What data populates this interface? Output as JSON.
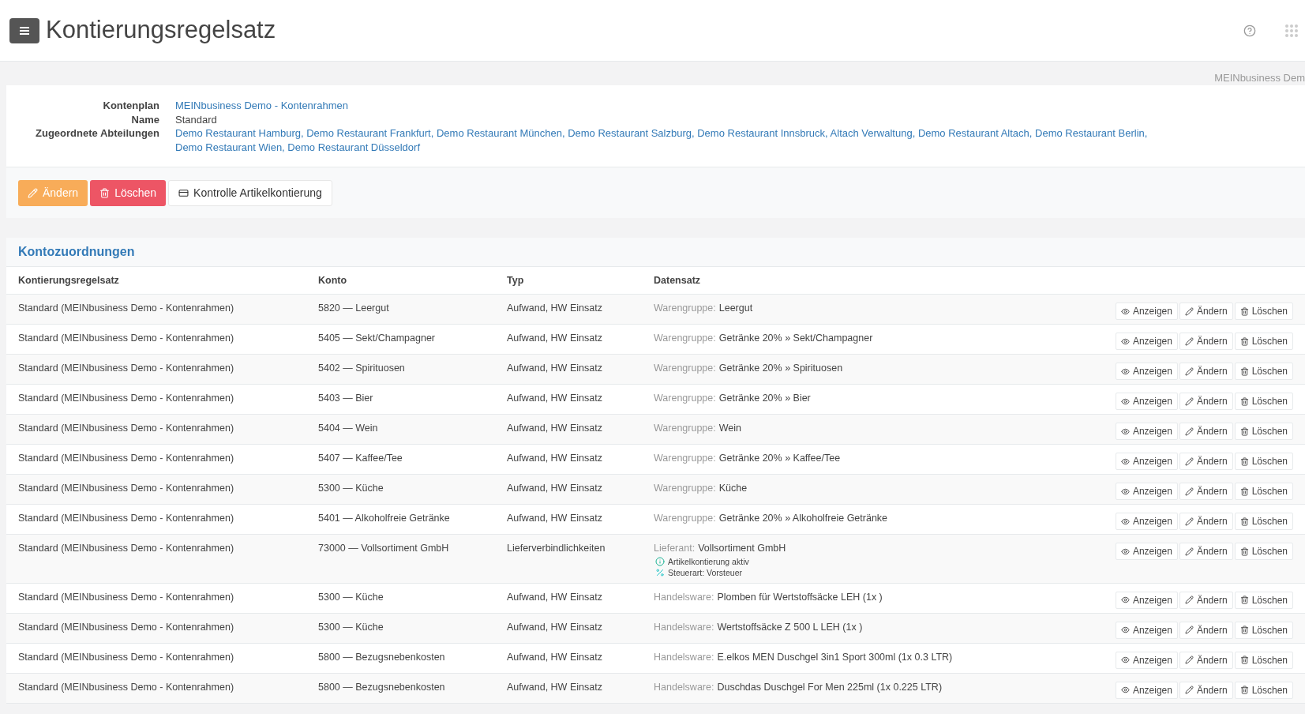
{
  "header": {
    "title": "Kontierungsregelsatz"
  },
  "breadcrumb": "MEINbusiness Dem",
  "details": [
    {
      "label": "Kontenplan",
      "kind": "link",
      "values": [
        "MEINbusiness Demo - Kontenrahmen"
      ]
    },
    {
      "label": "Name",
      "kind": "text",
      "values": [
        "Standard"
      ]
    },
    {
      "label": "Zugeordnete Abteilungen",
      "kind": "link",
      "values": [
        "Demo Restaurant Hamburg,",
        "Demo Restaurant Frankfurt,",
        "Demo Restaurant München,",
        "Demo Restaurant Salzburg,",
        "Demo Restaurant Innsbruck,",
        "Altach Verwaltung,",
        "Demo Restaurant Altach,",
        "Demo Restaurant Berlin,",
        "Demo Restaurant Wien,",
        "Demo Restaurant Düsseldorf"
      ]
    }
  ],
  "actions": [
    {
      "kind": "edit",
      "label": "Ändern"
    },
    {
      "kind": "delete",
      "label": "Löschen"
    },
    {
      "kind": "check",
      "label": "Kontrolle Artikelkontierung"
    }
  ],
  "section": {
    "title": "Kontozuordnungen"
  },
  "table": {
    "columns": [
      "Kontierungsregelsatz",
      "Konto",
      "Typ",
      "Datensatz"
    ],
    "rows": [
      {
        "regelsatz": "Standard (MEINbusiness Demo - Kontenrahmen)",
        "konto": "5820 — Leergut",
        "typ": "Aufwand, HW Einsatz",
        "source": "Warengruppe:",
        "record": "Leergut",
        "actions": [
          {
            "kind": "view",
            "label": "Anzeigen"
          },
          {
            "kind": "edit",
            "label": "Ändern"
          },
          {
            "kind": "delete",
            "label": "Löschen"
          }
        ]
      },
      {
        "regelsatz": "Standard (MEINbusiness Demo - Kontenrahmen)",
        "konto": "5405 — Sekt/Champagner",
        "typ": "Aufwand, HW Einsatz",
        "source": "Warengruppe:",
        "record": "Getränke 20% » Sekt/Champagner",
        "actions": [
          {
            "kind": "view",
            "label": "Anzeigen"
          },
          {
            "kind": "edit",
            "label": "Ändern"
          },
          {
            "kind": "delete",
            "label": "Löschen"
          }
        ]
      },
      {
        "regelsatz": "Standard (MEINbusiness Demo - Kontenrahmen)",
        "konto": "5402 — Spirituosen",
        "typ": "Aufwand, HW Einsatz",
        "source": "Warengruppe:",
        "record": "Getränke 20% » Spirituosen",
        "actions": [
          {
            "kind": "view",
            "label": "Anzeigen"
          },
          {
            "kind": "edit",
            "label": "Ändern"
          },
          {
            "kind": "delete",
            "label": "Löschen"
          }
        ]
      },
      {
        "regelsatz": "Standard (MEINbusiness Demo - Kontenrahmen)",
        "konto": "5403 — Bier",
        "typ": "Aufwand, HW Einsatz",
        "source": "Warengruppe:",
        "record": "Getränke 20% » Bier",
        "actions": [
          {
            "kind": "view",
            "label": "Anzeigen"
          },
          {
            "kind": "edit",
            "label": "Ändern"
          },
          {
            "kind": "delete",
            "label": "Löschen"
          }
        ]
      },
      {
        "regelsatz": "Standard (MEINbusiness Demo - Kontenrahmen)",
        "konto": "5404 — Wein",
        "typ": "Aufwand, HW Einsatz",
        "source": "Warengruppe:",
        "record": "Wein",
        "actions": [
          {
            "kind": "view",
            "label": "Anzeigen"
          },
          {
            "kind": "edit",
            "label": "Ändern"
          },
          {
            "kind": "delete",
            "label": "Löschen"
          }
        ]
      },
      {
        "regelsatz": "Standard (MEINbusiness Demo - Kontenrahmen)",
        "konto": "5407 — Kaffee/Tee",
        "typ": "Aufwand, HW Einsatz",
        "source": "Warengruppe:",
        "record": "Getränke 20% » Kaffee/Tee",
        "actions": [
          {
            "kind": "view",
            "label": "Anzeigen"
          },
          {
            "kind": "edit",
            "label": "Ändern"
          },
          {
            "kind": "delete",
            "label": "Löschen"
          }
        ]
      },
      {
        "regelsatz": "Standard (MEINbusiness Demo - Kontenrahmen)",
        "konto": "5300 — Küche",
        "typ": "Aufwand, HW Einsatz",
        "source": "Warengruppe:",
        "record": "Küche",
        "actions": [
          {
            "kind": "view",
            "label": "Anzeigen"
          },
          {
            "kind": "edit",
            "label": "Ändern"
          },
          {
            "kind": "delete",
            "label": "Löschen"
          }
        ]
      },
      {
        "regelsatz": "Standard (MEINbusiness Demo - Kontenrahmen)",
        "konto": "5401 — Alkoholfreie Getränke",
        "typ": "Aufwand, HW Einsatz",
        "source": "Warengruppe:",
        "record": "Getränke 20% » Alkoholfreie Getränke",
        "actions": [
          {
            "kind": "view",
            "label": "Anzeigen"
          },
          {
            "kind": "edit",
            "label": "Ändern"
          },
          {
            "kind": "delete",
            "label": "Löschen"
          }
        ]
      },
      {
        "regelsatz": "Standard (MEINbusiness Demo - Kontenrahmen)",
        "konto": "73000 — Vollsortiment GmbH",
        "typ": "Lieferverbindlichkeiten",
        "source": "Lieferant:",
        "record": "Vollsortiment GmbH",
        "notes": [
          {
            "kind": "info",
            "text": "Artikelkontierung aktiv"
          },
          {
            "kind": "percent",
            "text": "Steuerart: Vorsteuer"
          }
        ],
        "actions": [
          {
            "kind": "view",
            "label": "Anzeigen"
          },
          {
            "kind": "edit",
            "label": "Ändern"
          },
          {
            "kind": "delete",
            "label": "Löschen"
          }
        ]
      },
      {
        "regelsatz": "Standard (MEINbusiness Demo - Kontenrahmen)",
        "konto": "5300 — Küche",
        "typ": "Aufwand, HW Einsatz",
        "source": "Handelsware:",
        "record": "Plomben für Wertstoffsäcke LEH (1x )",
        "actions": [
          {
            "kind": "view",
            "label": "Anzeigen"
          },
          {
            "kind": "edit",
            "label": "Ändern"
          },
          {
            "kind": "delete",
            "label": "Löschen"
          }
        ]
      },
      {
        "regelsatz": "Standard (MEINbusiness Demo - Kontenrahmen)",
        "konto": "5300 — Küche",
        "typ": "Aufwand, HW Einsatz",
        "source": "Handelsware:",
        "record": "Wertstoffsäcke Z 500 L LEH (1x )",
        "actions": [
          {
            "kind": "view",
            "label": "Anzeigen"
          },
          {
            "kind": "edit",
            "label": "Ändern"
          },
          {
            "kind": "delete",
            "label": "Löschen"
          }
        ]
      },
      {
        "regelsatz": "Standard (MEINbusiness Demo - Kontenrahmen)",
        "konto": "5800 — Bezugsnebenkosten",
        "typ": "Aufwand, HW Einsatz",
        "source": "Handelsware:",
        "record": "E.elkos MEN Duschgel 3in1 Sport 300ml (1x 0.3 LTR)",
        "actions": [
          {
            "kind": "view",
            "label": "Anzeigen"
          },
          {
            "kind": "edit",
            "label": "Ändern"
          },
          {
            "kind": "delete",
            "label": "Löschen"
          }
        ]
      },
      {
        "regelsatz": "Standard (MEINbusiness Demo - Kontenrahmen)",
        "konto": "5800 — Bezugsnebenkosten",
        "typ": "Aufwand, HW Einsatz",
        "source": "Handelsware:",
        "record": "Duschdas Duschgel For Men 225ml (1x 0.225 LTR)",
        "actions": [
          {
            "kind": "view",
            "label": "Anzeigen"
          },
          {
            "kind": "edit",
            "label": "Ändern"
          },
          {
            "kind": "delete",
            "label": "Löschen"
          }
        ]
      }
    ]
  }
}
